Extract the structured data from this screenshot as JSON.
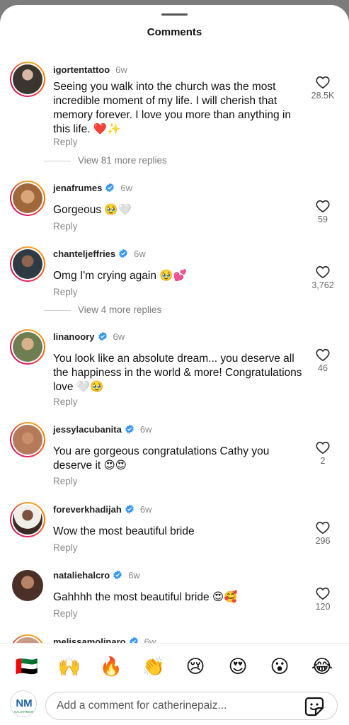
{
  "header": {
    "title": "Comments"
  },
  "comments": [
    {
      "user": "igortentattoo",
      "verified": false,
      "age": "6w",
      "text": "Seeing you walk into the church was the most incredible moment of my life. I will cherish that memory forever. I love you more than anything in this life. ❤️✨",
      "reply": "Reply",
      "likes": "28.5K",
      "more_replies": "View 81 more replies",
      "avatar_color": "#3b3530"
    },
    {
      "user": "jenafrumes",
      "verified": true,
      "age": "6w",
      "text": "Gorgeous 🥹🤍",
      "reply": "Reply",
      "likes": "59",
      "more_replies": "",
      "avatar_color": "#a0683a"
    },
    {
      "user": "chanteljeffries",
      "verified": true,
      "age": "6w",
      "text": "Omg I'm crying again 🥹💕",
      "reply": "Reply",
      "likes": "3,762",
      "more_replies": "View 4 more replies",
      "avatar_color": "#2f3b44"
    },
    {
      "user": "linanoory",
      "verified": true,
      "age": "6w",
      "text": "You look like an absolute dream... you deserve all the happiness in the world & more! Congratulations love 🤍🥹",
      "reply": "Reply",
      "likes": "46",
      "more_replies": "",
      "avatar_color": "#6e7d52"
    },
    {
      "user": "jessylacubanita",
      "verified": true,
      "age": "6w",
      "text": "You are gorgeous congratulations Cathy you deserve it 😍😍",
      "reply": "Reply",
      "likes": "2",
      "more_replies": "",
      "avatar_color": "#b57a5c"
    },
    {
      "user": "foreverkhadijah",
      "verified": true,
      "age": "6w",
      "text": "Wow the most beautiful bride",
      "reply": "Reply",
      "likes": "296",
      "more_replies": "",
      "avatar_color": "#3a2a24"
    },
    {
      "user": "nataliehalcro",
      "verified": true,
      "age": "6w",
      "text": "Gahhhh the most beautiful bride 😍🥰",
      "reply": "Reply",
      "likes": "120",
      "more_replies": "",
      "avatar_color": "#4a3026"
    },
    {
      "user": "melissamolinaro",
      "verified": true,
      "age": "6w",
      "text": "",
      "reply": "",
      "likes": "",
      "more_replies": "",
      "avatar_color": "#c89a86"
    }
  ],
  "emoji_bar": [
    "🇦🇪",
    "🙌",
    "🔥",
    "👏",
    "😢",
    "😍",
    "😮",
    "😂"
  ],
  "composer": {
    "placeholder": "Add a comment for catherinepaiz...",
    "avatar_label": "NM",
    "avatar_sublabel": "NAIJATREND"
  },
  "colors": {
    "verified": "#3897f0",
    "heart_stroke": "#262626",
    "ring_start": "#f9a825",
    "ring_end": "#c2185b"
  },
  "icons": {
    "like": "heart-outline-icon",
    "verified": "verified-badge-icon",
    "sticker": "sticker-icon"
  }
}
